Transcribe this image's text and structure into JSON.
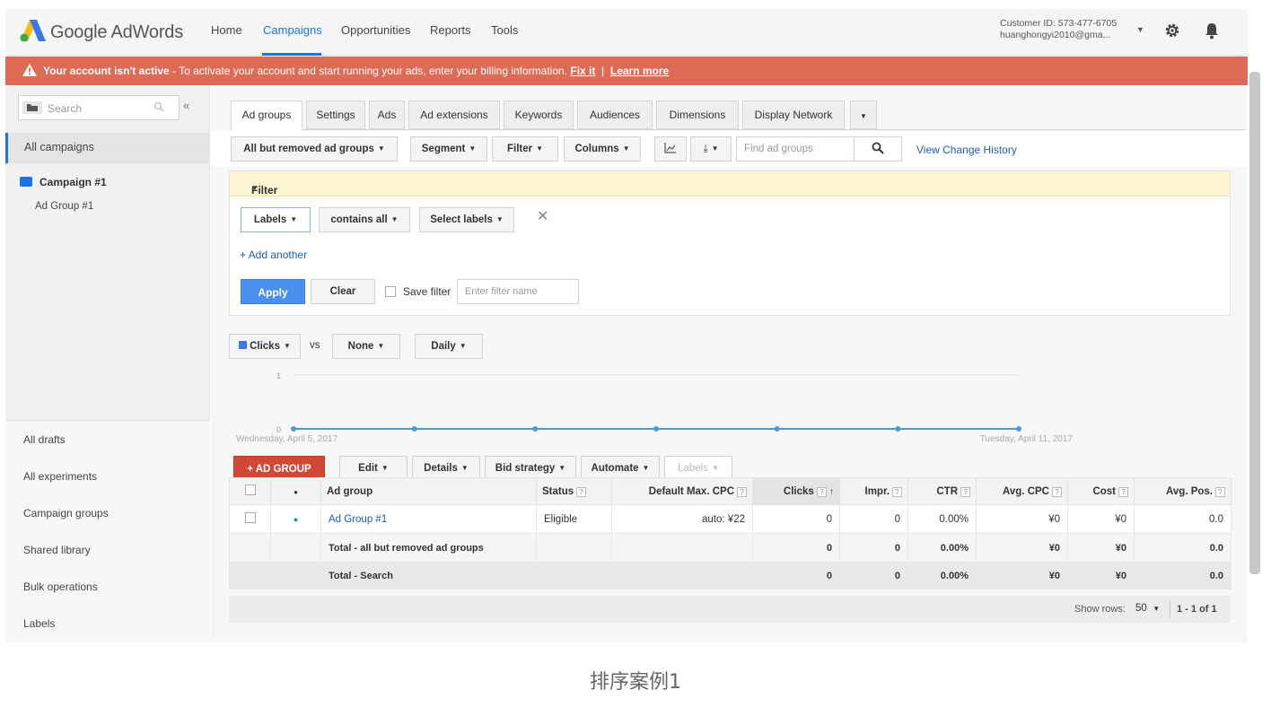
{
  "app": {
    "logo_text": "Google AdWords",
    "nav": [
      "Home",
      "Campaigns",
      "Opportunities",
      "Reports",
      "Tools"
    ],
    "customer_id": "Customer ID: 573-477-6705",
    "customer_email": "huanghongyi2010@gma..."
  },
  "alert": {
    "bold": "Your account isn't active",
    "text": " - To activate your account and start running your ads, enter your billing information.",
    "fix": "Fix it",
    "sep": "|",
    "learn": "Learn more"
  },
  "sidebar": {
    "search_placeholder": "Search",
    "all_campaigns": "All campaigns",
    "campaign": "Campaign #1",
    "ad_group": "Ad Group #1",
    "links": [
      "All drafts",
      "All experiments",
      "Campaign groups",
      "Shared library",
      "Bulk operations",
      "Labels"
    ]
  },
  "tabs": [
    "Ad groups",
    "Settings",
    "Ads",
    "Ad extensions",
    "Keywords",
    "Audiences",
    "Dimensions",
    "Display Network"
  ],
  "toolbar": {
    "view": "All but removed ad groups",
    "segment": "Segment",
    "filter": "Filter",
    "columns": "Columns",
    "find_placeholder": "Find ad groups",
    "history": "View Change History"
  },
  "filter": {
    "title": "Filter",
    "labels": "Labels",
    "contains": "contains all",
    "select": "Select labels",
    "add": "+ Add another",
    "apply": "Apply",
    "clear": "Clear",
    "save": "Save filter",
    "name_placeholder": "Enter filter name"
  },
  "chart_controls": {
    "metric": "Clicks",
    "vs": "vs",
    "none": "None",
    "period": "Daily"
  },
  "chart_data": {
    "type": "line",
    "x": [
      "Wednesday, April 5, 2017",
      "",
      "",
      "",
      "",
      "",
      "Tuesday, April 11, 2017"
    ],
    "series": [
      {
        "values": [
          0,
          0,
          0,
          0,
          0,
          0,
          0
        ]
      }
    ],
    "ylim": [
      0,
      1
    ],
    "yticks": [
      "0",
      "1"
    ],
    "color": "#4a9ad4"
  },
  "actions": {
    "add": "+ AD GROUP",
    "edit": "Edit",
    "details": "Details",
    "bid": "Bid strategy",
    "automate": "Automate",
    "labels": "Labels"
  },
  "table": {
    "headers": [
      "Ad group",
      "Status",
      "Default Max. CPC",
      "Clicks",
      "Impr.",
      "CTR",
      "Avg. CPC",
      "Cost",
      "Avg. Pos."
    ],
    "row": {
      "name": "Ad Group #1",
      "status": "Eligible",
      "cpc": "auto: ¥22",
      "clicks": "0",
      "impr": "0",
      "ctr": "0.00%",
      "avg_cpc": "¥0",
      "cost": "¥0",
      "pos": "0.0"
    },
    "total1": {
      "label": "Total - all but removed ad groups",
      "clicks": "0",
      "impr": "0",
      "ctr": "0.00%",
      "avg_cpc": "¥0",
      "cost": "¥0",
      "pos": "0.0"
    },
    "total2": {
      "label": "Total - Search",
      "clicks": "0",
      "impr": "0",
      "ctr": "0.00%",
      "avg_cpc": "¥0",
      "cost": "¥0",
      "pos": "0.0"
    }
  },
  "pager": {
    "show_rows": "Show rows:",
    "rows": "50",
    "range": "1 - 1 of 1"
  },
  "caption": "排序案例1"
}
